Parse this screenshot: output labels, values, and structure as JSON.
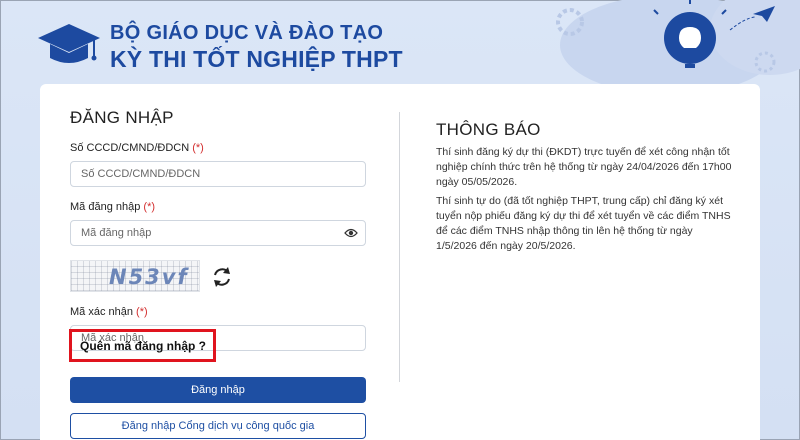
{
  "header": {
    "line1": "BỘ GIÁO DỤC VÀ ĐÀO TẠO",
    "line2": "KỲ THI TỐT NGHIỆP THPT"
  },
  "login": {
    "title": "ĐĂNG NHẬP",
    "id_label": "Số CCCD/CMND/ĐDCN",
    "id_required": "(*)",
    "id_placeholder": "Số CCCD/CMND/ĐDCN",
    "code_label": "Mã đăng nhập",
    "code_required": "(*)",
    "code_placeholder": "Mã đăng nhập",
    "captcha_text": "N53vf",
    "verify_label": "Mã xác nhận",
    "verify_required": "(*)",
    "verify_placeholder": "Mã xác nhận",
    "forgot_link": "Quên mã đăng nhập ?",
    "login_button": "Đăng nhập",
    "portal_button": "Đăng nhập Cổng dịch vụ công quốc gia"
  },
  "notice": {
    "title": "THÔNG BÁO",
    "paragraph1": "Thí sinh đăng ký dự thi (ĐKDT) trực tuyến để xét công nhận tốt nghiệp chính thức trên hệ thống từ ngày 24/04/2026 đến 17h00 ngày 05/05/2026.",
    "paragraph2": "Thí sinh tự do (đã tốt nghiệp THPT, trung cấp) chỉ đăng ký xét tuyển nộp phiếu đăng ký dự thi để xét tuyển về các điểm TNHS để các điểm TNHS nhập thông tin lên hệ thống từ ngày 1/5/2026 đến ngày 20/5/2026."
  },
  "colors": {
    "brand_blue": "#1d4aa0",
    "button_blue": "#1e4fa3",
    "required_red": "#d32f2f",
    "highlight_red": "#e0141e",
    "background": "#dbe6f7"
  },
  "icons": [
    "graduation-cap-icon",
    "lightbulb-icon",
    "paper-plane-icon",
    "eye-icon",
    "refresh-icon"
  ]
}
